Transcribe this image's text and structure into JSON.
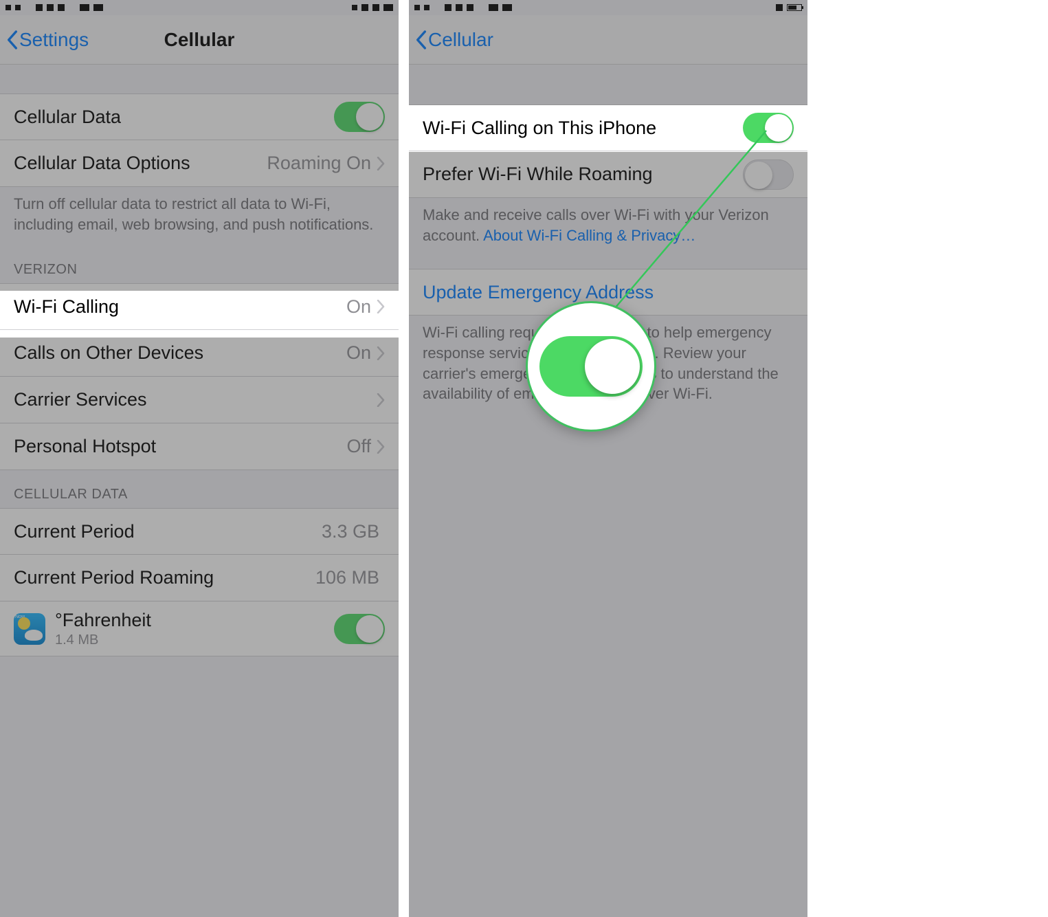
{
  "left": {
    "nav": {
      "back": "Settings",
      "title": "Cellular"
    },
    "cellular_data": {
      "label": "Cellular Data",
      "on": true
    },
    "cellular_data_options": {
      "label": "Cellular Data Options",
      "value": "Roaming On"
    },
    "data_footer": "Turn off cellular data to restrict all data to Wi-Fi, including email, web browsing, and push notifications.",
    "carrier_header": "VERIZON",
    "wifi_calling": {
      "label": "Wi-Fi Calling",
      "value": "On"
    },
    "calls_other": {
      "label": "Calls on Other Devices",
      "value": "On"
    },
    "carrier_services": {
      "label": "Carrier Services"
    },
    "personal_hotspot": {
      "label": "Personal Hotspot",
      "value": "Off"
    },
    "usage_header": "CELLULAR DATA",
    "current_period": {
      "label": "Current Period",
      "value": "3.3 GB"
    },
    "current_period_roaming": {
      "label": "Current Period Roaming",
      "value": "106 MB"
    },
    "app1": {
      "name": "°Fahrenheit",
      "size": "1.4 MB",
      "on": true,
      "icon_tag": "Now"
    }
  },
  "right": {
    "nav": {
      "back": "Cellular",
      "title": ""
    },
    "wifi_calling_on_this": {
      "label": "Wi-Fi Calling on This iPhone",
      "on": true
    },
    "prefer_roaming": {
      "label": "Prefer Wi-Fi While Roaming",
      "on": false
    },
    "footer1_a": "Make and receive calls over Wi-Fi with your Verizon account. ",
    "footer1_link": "About Wi-Fi Calling & Privacy…",
    "update_addr": "Update Emergency Address",
    "footer2": "Wi-Fi calling requires an address to help emergency response services respond to calls. Review your carrier's emergency calling policies to understand the availability of emergency calling over Wi-Fi."
  }
}
